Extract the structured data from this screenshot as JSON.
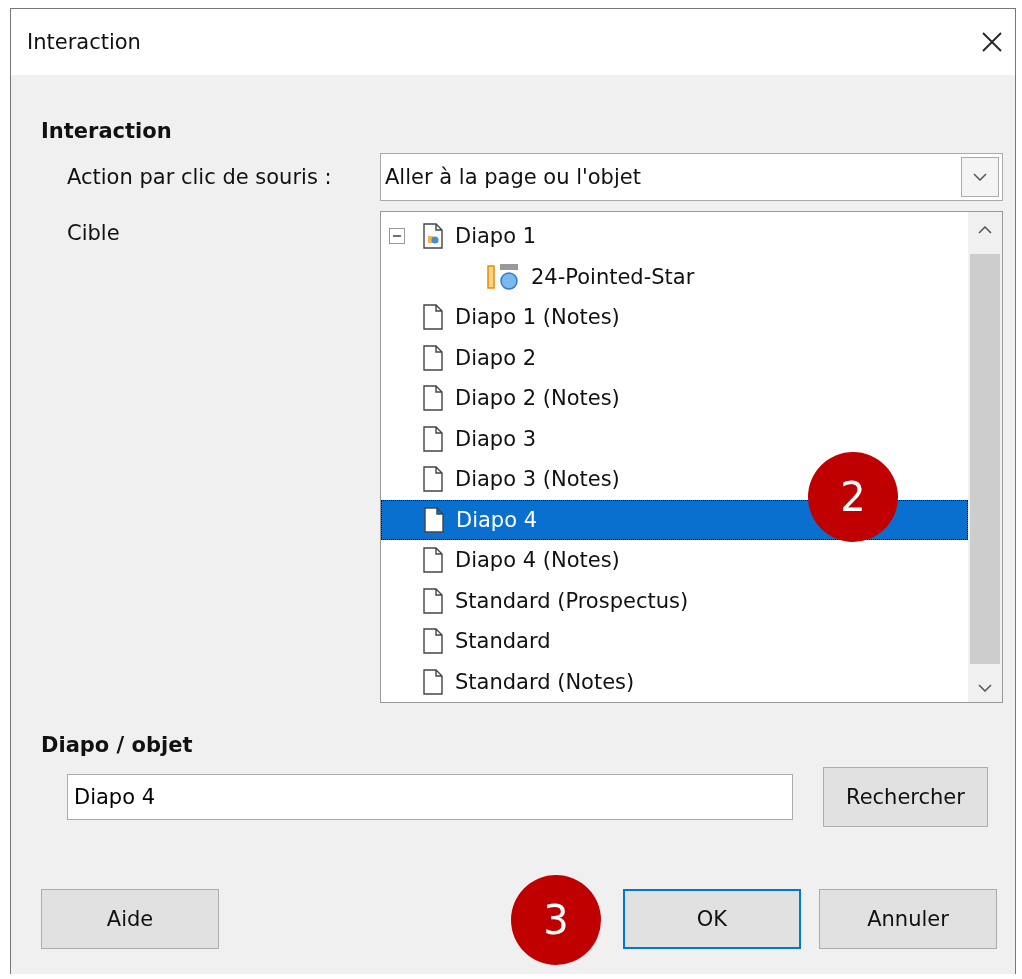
{
  "window": {
    "title": "Interaction"
  },
  "section_title": "Interaction",
  "action": {
    "label": "Action par clic de souris :",
    "value": "Aller à la page ou l'objet"
  },
  "target": {
    "label": "Cible",
    "items": [
      {
        "label": "Diapo 1",
        "kind": "slide-objects",
        "expanded": true,
        "selected": false,
        "children": [
          {
            "label": "24-Pointed-Star",
            "kind": "shape",
            "selected": false
          }
        ]
      },
      {
        "label": "Diapo 1 (Notes)",
        "kind": "page",
        "selected": false
      },
      {
        "label": "Diapo 2",
        "kind": "page",
        "selected": false
      },
      {
        "label": "Diapo 2 (Notes)",
        "kind": "page",
        "selected": false
      },
      {
        "label": "Diapo 3",
        "kind": "page",
        "selected": false
      },
      {
        "label": "Diapo 3 (Notes)",
        "kind": "page",
        "selected": false
      },
      {
        "label": "Diapo 4",
        "kind": "page",
        "selected": true
      },
      {
        "label": "Diapo 4 (Notes)",
        "kind": "page",
        "selected": false
      },
      {
        "label": "Standard (Prospectus)",
        "kind": "page",
        "selected": false
      },
      {
        "label": "Standard",
        "kind": "page",
        "selected": false
      },
      {
        "label": "Standard (Notes)",
        "kind": "page",
        "selected": false
      }
    ]
  },
  "object_section": {
    "title": "Diapo / objet",
    "value": "Diapo 4",
    "search_button": "Rechercher"
  },
  "buttons": [
    {
      "label": "Aide",
      "kind": "help",
      "focused": false
    },
    {
      "label": "OK",
      "kind": "ok",
      "focused": true
    },
    {
      "label": "Annuler",
      "kind": "cancel",
      "focused": false
    }
  ],
  "callouts": [
    {
      "text": "2",
      "kind": "tree"
    },
    {
      "text": "3",
      "kind": "buttons"
    }
  ]
}
